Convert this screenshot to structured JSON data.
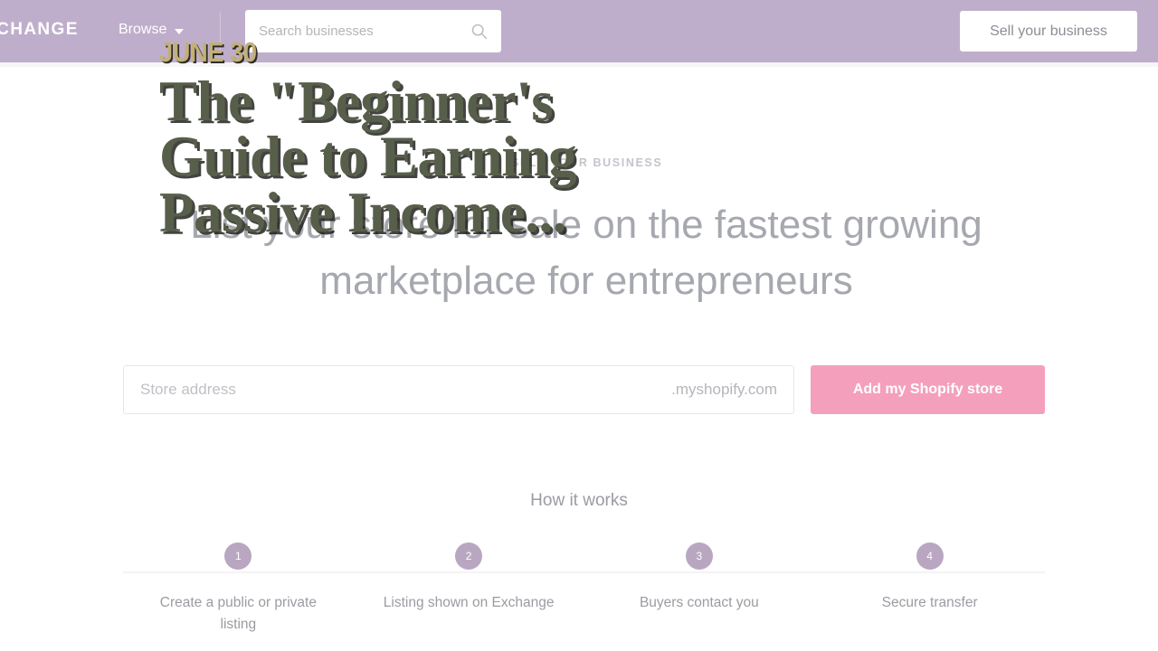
{
  "header": {
    "logo": "XCHANGE",
    "browse_label": "Browse",
    "caret_icon": "chevron-down-icon",
    "search": {
      "placeholder": "Search businesses",
      "value": "",
      "icon": "search-icon"
    },
    "sell_button": "Sell your business",
    "background_color": "#bfaecb"
  },
  "hero": {
    "eyebrow": "SELL YOUR BUSINESS",
    "title": "List your store for sale on the fastest growing marketplace for entrepreneurs"
  },
  "signup": {
    "address_placeholder": "Store address",
    "address_value": "",
    "domain_suffix": ".myshopify.com",
    "submit_label": "Add my Shopify store",
    "submit_color": "#f4a0bd"
  },
  "how_it_works": {
    "heading": "How it works",
    "steps": [
      {
        "number": "1",
        "label": "Create a public or private listing"
      },
      {
        "number": "2",
        "label": "Listing shown on Exchange"
      },
      {
        "number": "3",
        "label": "Buyers contact you"
      },
      {
        "number": "4",
        "label": "Secure transfer"
      }
    ],
    "circle_color": "#b9a7c1"
  },
  "video_overlay": {
    "date": "JUNE 30",
    "date_color": "#c2b077",
    "title": "The \"Beginner's Guide to Earning Passive Income...",
    "title_color": "#575f4b"
  }
}
